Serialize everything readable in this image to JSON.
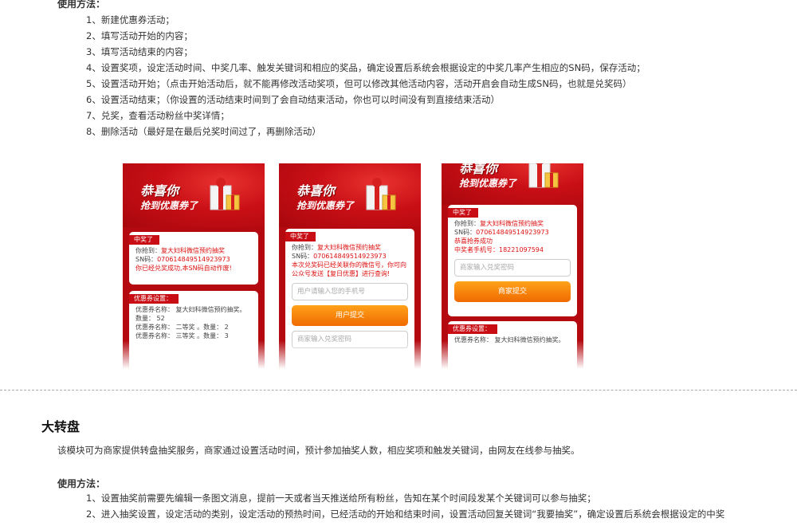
{
  "usage_heading": "使用方法：",
  "steps": [
    "1、新建优惠券活动；",
    "2、填写活动开始的内容；",
    "3、填写活动结束的内容；",
    "4、设置奖项，设定活动时间、中奖几率、触发关键词和相应的奖品，确定设置后系统会根据设定的中奖几率产生相应的SN码，保存活动；",
    "5、设置活动开始；（点击开始活动后，就不能再修改活动奖项，但可以修改其他活动内容，活动开启会自动生成SN码，也就是兑奖码）",
    "6、设置活动结束；（你设置的活动结束时间到了会自动结束活动，你也可以时间没有到直接结束活动）",
    "7、兑奖，查看活动粉丝中奖详情；",
    "8、删除活动（最好是在最后兑奖时间过了，再删除活动）"
  ],
  "phones": {
    "banner_title": "恭喜你",
    "banner_sub": "抢到优惠券了",
    "win_tag": "中奖了",
    "coupon_tag": "优惠券设置：",
    "p1": {
      "won_label": "你抢到：",
      "won_value": "复大妇科微信预约抽奖",
      "sn_label": "SN码：",
      "sn_value": "070614849514923973",
      "note": "你已经兑奖成功,本SN码自动作废!",
      "coupon_name": "优惠券名称： 复大妇科微信预约抽奖。",
      "count": "数量： 52",
      "c2": "优惠券名称： 二等奖 。数量： 2",
      "c3": "优惠券名称： 三等奖 。数量： 3"
    },
    "p2": {
      "won_label": "你抢到：",
      "won_value": "复大妇科微信预约抽奖",
      "sn_label": "SN码：",
      "sn_value": "070614849514923973",
      "note": "本次兑奖码已经关联你的微信号，你可向公众号发送【复日优惠】进行查询!",
      "phone_placeholder": "用户请输入您的手机号",
      "submit": "用户提交",
      "merchant_placeholder": "商家输入兑奖密码"
    },
    "p3": {
      "won_label": "你抢到：",
      "won_value": "复大妇科微信预约抽奖",
      "sn_label": "SN码：",
      "sn_value": "070614849514923973",
      "success": "恭喜抢券成功",
      "phone_label": "中奖者手机号：",
      "phone_value": "18221097594",
      "merchant_placeholder": "商家输入兑奖密码",
      "submit": "商家提交",
      "coupon_name": "优惠券名称： 复大妇科微信预约抽奖。"
    }
  },
  "section_title": "大转盘",
  "intro": "该模块可为商家提供转盘抽奖服务，商家通过设置活动时间，预计参加抽奖人数，相应奖项和触发关键词，由网友在线参与抽奖。",
  "usage_heading2": "使用方法：",
  "steps2": [
    "1、设置抽奖前需要先编辑一条图文消息，提前一天或者当天推送给所有粉丝，告知在某个时间段发某个关键词可以参与抽奖；",
    "2、进入抽奖设置，设定活动的类别，设定活动的预热时间，已经活动的开始和结束时间，设置活动回复关键词“我要抽奖”，确定设置后系统会根据设定的中奖"
  ]
}
